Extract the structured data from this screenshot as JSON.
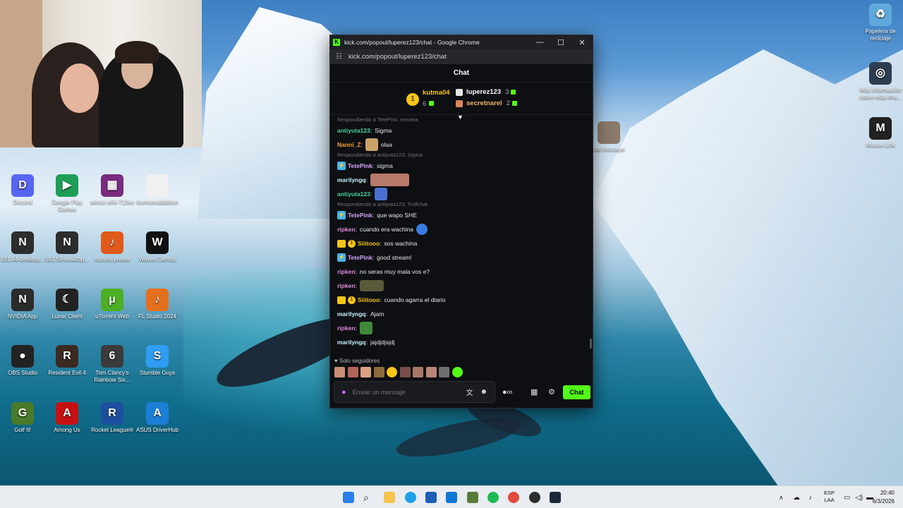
{
  "desktop": {
    "icons": [
      {
        "label": "Discord",
        "color": "#5865f2",
        "glyph": "D"
      },
      {
        "label": "Google Play Games",
        "color": "#1e9e57",
        "glyph": "▶"
      },
      {
        "label": "winrar-x64-713es",
        "color": "#7a2a7f",
        "glyph": "▦"
      },
      {
        "label": "licensevalidation",
        "color": "#f0f0f0",
        "glyph": ""
      },
      {
        "label": "591.44-desktop...",
        "color": "#2d2d2d",
        "glyph": "N"
      },
      {
        "label": "591.59-desktop...",
        "color": "#2d2d2d",
        "glyph": "N"
      },
      {
        "label": "nativos preset",
        "color": "#e05a1c",
        "glyph": "♪"
      },
      {
        "label": "Waves Central",
        "color": "#111111",
        "glyph": "W"
      },
      {
        "label": "NVIDIA App",
        "color": "#2b2b2b",
        "glyph": "N"
      },
      {
        "label": "Lunar Client",
        "color": "#222222",
        "glyph": "☾"
      },
      {
        "label": "uTorrent Web",
        "color": "#4caf24",
        "glyph": "μ"
      },
      {
        "label": "FL Studio 2024",
        "color": "#e4701e",
        "glyph": "♪"
      },
      {
        "label": "OBS Studio",
        "color": "#222222",
        "glyph": "●"
      },
      {
        "label": "Resident Evil 4",
        "color": "#3a2a22",
        "glyph": "R"
      },
      {
        "label": "Tom Clancy's Rainbow Six...",
        "color": "#3a3a3a",
        "glyph": "6"
      },
      {
        "label": "Stumble Guys",
        "color": "#2f9df4",
        "glyph": "S"
      },
      {
        "label": "Golf It!",
        "color": "#4a7a2a",
        "glyph": "G"
      },
      {
        "label": "Among Us",
        "color": "#c51111",
        "glyph": "A"
      },
      {
        "label": "Rocket League®",
        "color": "#1d4fa0",
        "glyph": "R"
      },
      {
        "label": "ASUS DriverHub",
        "color": "#1c7fd6",
        "glyph": "A"
      },
      {
        "label": "Papelera de reciclaje",
        "color": "#5fa8dc",
        "glyph": "♻"
      },
      {
        "label": "Más información sobre esta ima...",
        "color": "#2c3e50",
        "glyph": "◎"
      },
      {
        "label": "Mouse Link",
        "color": "#222222",
        "glyph": "M"
      },
      {
        "label": "cat crosseye",
        "color": "#8a7a6a",
        "glyph": ""
      }
    ]
  },
  "browser": {
    "window_title": "kick.com/popout/luperez123/chat - Google Chrome",
    "url": "kick.com/popout/luperez123/chat",
    "minimize": "—",
    "maximize": "☐",
    "close": "✕"
  },
  "chat": {
    "header": "Chat",
    "leaders": {
      "first": {
        "rank": "1",
        "name": "kutma04",
        "count": "6"
      },
      "second": {
        "name": "luperez123",
        "count": "3"
      },
      "third": {
        "name": "secretnarel",
        "count": "2"
      }
    },
    "messages": [
      {
        "reply": "Respondiendo a TetePink: emotea",
        "user": "antiyuta123",
        "color": "#4bd1a0",
        "text": "Sigma"
      },
      {
        "user": "Nanni_Z",
        "color": "#f2a43a",
        "emote": "#c9a46a",
        "text": "olaa"
      },
      {
        "reply": "Respondiendo a antiyuta123: Sigma",
        "user": "TetePink",
        "color": "#d5a6ff",
        "badge": "bolt",
        "text": "sigma"
      },
      {
        "user": "marilyngq",
        "color": "#c9f5ff",
        "emote_wide": "#b87a6a",
        "text": ""
      },
      {
        "user": "antiyuta123",
        "color": "#4bd1a0",
        "emote": "#4a6fd0",
        "text": ""
      },
      {
        "reply": "Respondiendo a antiyuta123: Trollchat",
        "user": "TetePink",
        "color": "#d5a6ff",
        "badge": "bolt",
        "text": "que wapo SHE"
      },
      {
        "user": "ripken",
        "color": "#e08ad9",
        "text": "cuando era wachina",
        "trail_emote": "#3b7be0"
      },
      {
        "user": "Siiitooo",
        "color": "#f5c518",
        "badge": "crown-one",
        "text": "sos wachina"
      },
      {
        "user": "TetePink",
        "color": "#d5a6ff",
        "badge": "bolt",
        "text": "good stream!"
      },
      {
        "user": "ripken",
        "color": "#e08ad9",
        "text": "no seras muy mala vos e?"
      },
      {
        "user": "ripken",
        "color": "#e08ad9",
        "emote_wide2": "#5a5a3a",
        "text": ""
      },
      {
        "user": "Siiitooo",
        "color": "#f5c518",
        "badge": "crown-one",
        "text": "cuando agarra el diario"
      },
      {
        "user": "marilyngq",
        "color": "#c9f5ff",
        "text": "Ajam"
      },
      {
        "user": "ripken",
        "color": "#e08ad9",
        "emote": "#3f8a3a",
        "text": ""
      },
      {
        "user": "marilyngq",
        "color": "#c9f5ff",
        "text": "jajdjdjsjdj"
      }
    ],
    "followers_only": "Solo seguidores",
    "composer_placeholder": "Enviar un mensaje",
    "send_label": "Chat"
  },
  "taskbar": {
    "lang_top": "ESP",
    "lang_bottom": "LAA",
    "time": "20:40",
    "date": "6/3/2026"
  }
}
